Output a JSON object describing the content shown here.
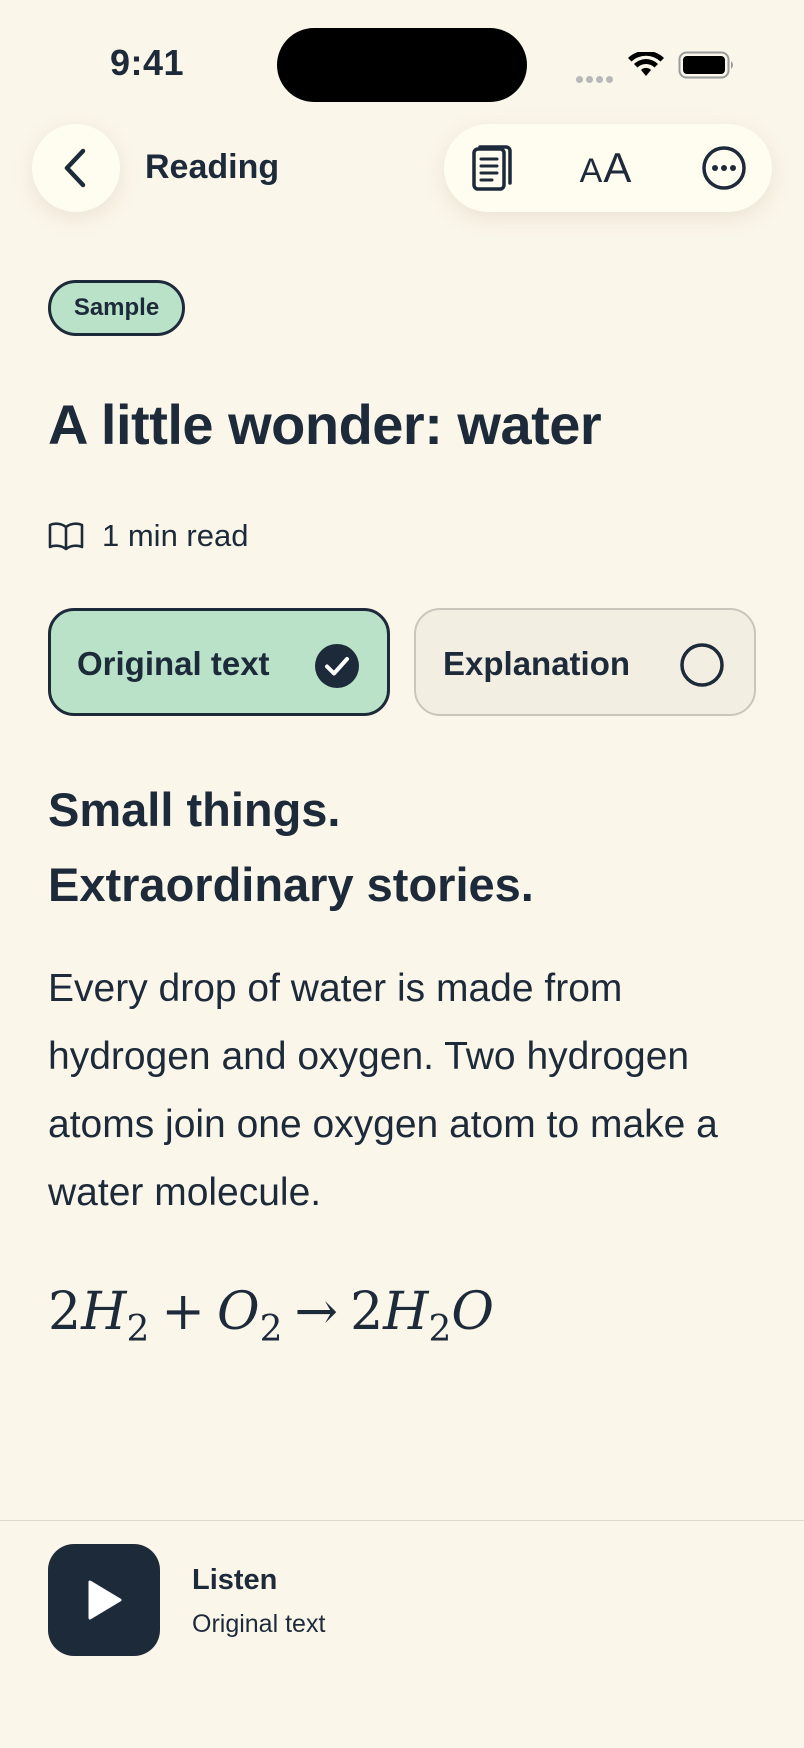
{
  "status_bar": {
    "time": "9:41"
  },
  "nav": {
    "back_icon": "chevron-left-icon",
    "title": "Reading",
    "toolbar_icons": [
      "document-icon",
      "text-size-icon",
      "more-icon"
    ],
    "text_size_label_small": "A",
    "text_size_label_large": "A"
  },
  "article": {
    "badge": "Sample",
    "title": "A little wonder: water",
    "read_time": "1 min read",
    "toggles": {
      "original": {
        "label": "Original text",
        "selected": true
      },
      "explanation": {
        "label": "Explanation",
        "selected": false
      }
    },
    "headline_line1": "Small things.",
    "headline_line2": "Extraordinary stories.",
    "body": "Every drop of water is made from hydrogen and oxygen. Two hydrogen atoms join one oxygen atom to make a water molecule.",
    "equation": {
      "coef1": "2",
      "h": "H",
      "sub1": "2",
      "plus": "+",
      "o": "O",
      "sub2": "2",
      "arrow": "→",
      "coef2": "2",
      "h2": "H",
      "sub3": "2",
      "o2": "O"
    }
  },
  "player": {
    "title": "Listen",
    "subtitle": "Original text"
  },
  "colors": {
    "background": "#fbf6ea",
    "ink": "#1d2a3a",
    "accent_green": "#b9e2c8",
    "card_neutral": "#f3eee2"
  }
}
